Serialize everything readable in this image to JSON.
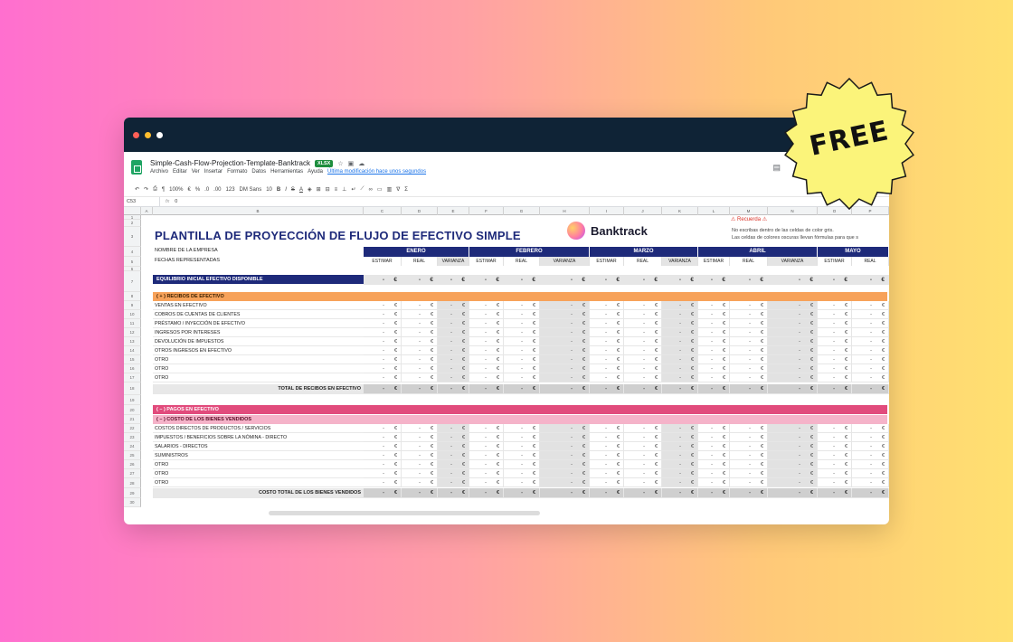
{
  "doc": {
    "name": "Simple-Cash-Flow-Projection-Template-Banktrack",
    "badge": "XLSX",
    "menu": [
      "Archivo",
      "Editar",
      "Ver",
      "Insertar",
      "Formato",
      "Datos",
      "Herramientas",
      "Ayuda"
    ],
    "last_edit": "Última modificación hace unos segundos"
  },
  "toolbar": {
    "zoom": "100%",
    "euro": "€",
    "pct": "%",
    "dec1": ".0",
    "dec2": ".00",
    "fmt": "123",
    "font": "DM Sans",
    "size": "10",
    "bold": "B",
    "italic": "I",
    "strike": "S",
    "color": "A"
  },
  "formula": {
    "ref": "C53",
    "fx": "fx",
    "value": "0"
  },
  "columns": [
    "A",
    "B",
    "C",
    "D",
    "E",
    "F",
    "G",
    "H",
    "I",
    "J",
    "K",
    "L",
    "M",
    "N",
    "O",
    "P"
  ],
  "rows": [
    "1",
    "2",
    "3",
    "4",
    "5",
    "6",
    "7",
    "8",
    "9",
    "10",
    "11",
    "12",
    "13",
    "14",
    "15",
    "16",
    "17",
    "18",
    "19",
    "20",
    "21",
    "22",
    "23",
    "24",
    "25",
    "26",
    "27",
    "28",
    "29",
    "30"
  ],
  "sheet": {
    "title": "PLANTILLA DE PROYECCIÓN DE FLUJO DE EFECTIVO SIMPLE",
    "brand": "Banktrack",
    "note_head": "⚠ Recuerda ⚠",
    "note1": "No escribas dentro de las celdas de color gris.",
    "note2": "Las celdas de colores oscuras llevan fórmulas para que s",
    "company_label": "NOMBRE DE LA EMPRESA",
    "dates_label": "FECHAS REPRESENTADAS",
    "months": [
      "ENERO",
      "FEBRERO",
      "MARZO",
      "ABRIL",
      "MAYO"
    ],
    "subheads": [
      "ESTIMAR",
      "REAL",
      "VARIANZA"
    ],
    "opening": "EQUILIBRIO INICIAL EFECTIVO DISPONIBLE",
    "receipts_band": "( + )  RECIBOS DE EFECTIVO",
    "receipts": [
      "VENTAS EN EFECTIVO",
      "COBROS DE CUENTAS DE CLIENTES",
      "PRÉSTAMO / INYECCIÓN DE EFECTIVO",
      "INGRESOS POR INTERESES",
      "DEVOLUCIÓN DE IMPUESTOS",
      "OTROS INGRESOS EN EFECTIVO",
      "OTRO",
      "OTRO",
      "OTRO"
    ],
    "receipts_total": "TOTAL DE RECIBOS EN EFECTIVO",
    "payments_band": "( – )  PAGOS EN EFECTIVO",
    "cogs_band": "( – )  COSTO DE LOS BIENES VENDIDOS",
    "cogs": [
      "COSTOS DIRECTOS DE PRODUCTOS / SERVICIOS",
      "IMPUESTOS / BENEFICIOS SOBRE LA NÓMINA - DIRECTO",
      "SALARIOS - DIRECTOS",
      "SUMINISTROS",
      "OTRO",
      "OTRO",
      "OTRO"
    ],
    "cogs_total": "COSTO TOTAL DE LOS BIENES VENDIDOS",
    "dash": "-",
    "euro": "€"
  },
  "free_badge": "FREE"
}
